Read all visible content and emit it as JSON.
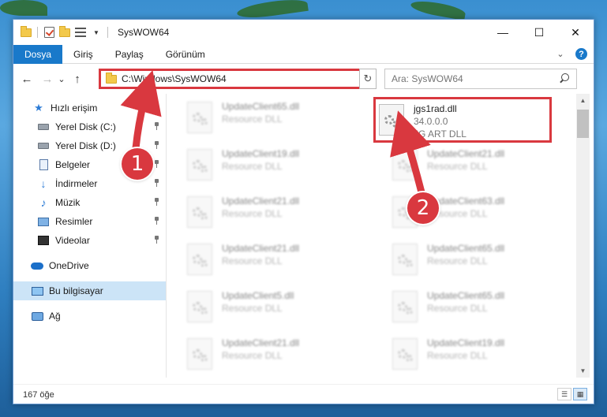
{
  "window": {
    "title": "SysWOW64",
    "minimize": "—",
    "maximize": "☐",
    "close": "✕"
  },
  "ribbon": {
    "tabs": [
      "Dosya",
      "Giriş",
      "Paylaş",
      "Görünüm"
    ],
    "help": "?"
  },
  "nav": {
    "back": "←",
    "forward": "→",
    "recent": "⌄",
    "up": "↑",
    "address": "C:\\Windows\\SysWOW64",
    "address_dropdown": "⌄",
    "refresh": "↻",
    "search_placeholder": "Ara: SysWOW64"
  },
  "sidebar": {
    "items": [
      {
        "label": "Hızlı erişim",
        "icon": "star-icon"
      },
      {
        "label": "Yerel Disk (C:)",
        "icon": "disk-icon",
        "pinned": true
      },
      {
        "label": "Yerel Disk (D:)",
        "icon": "disk-icon",
        "pinned": true
      },
      {
        "label": "Belgeler",
        "icon": "document-icon",
        "pinned": true
      },
      {
        "label": "İndirmeler",
        "icon": "download-icon",
        "pinned": true
      },
      {
        "label": "Müzik",
        "icon": "music-icon",
        "pinned": true
      },
      {
        "label": "Resimler",
        "icon": "pictures-icon",
        "pinned": true
      },
      {
        "label": "Videolar",
        "icon": "video-icon",
        "pinned": true
      },
      {
        "label": "OneDrive",
        "icon": "cloud-icon"
      },
      {
        "label": "Bu bilgisayar",
        "icon": "computer-icon",
        "selected": true
      },
      {
        "label": "Ağ",
        "icon": "network-icon"
      }
    ]
  },
  "files": [
    {
      "name": "UpdateClient65.dll",
      "type": "Resource DLL"
    },
    {
      "name": "jgs1rad.dll",
      "type": "34.0.0.0",
      "company": "JG ART DLL",
      "highlighted": true
    },
    {
      "name": "UpdateClient19.dll",
      "type": "Resource DLL"
    },
    {
      "name": "UpdateClient21.dll",
      "type": "Resource DLL"
    },
    {
      "name": "UpdateClient21.dll",
      "type": "Resource DLL"
    },
    {
      "name": "UpdateClient63.dll",
      "type": "Resource DLL"
    },
    {
      "name": "UpdateClient21.dll",
      "type": "Resource DLL"
    },
    {
      "name": "UpdateClient65.dll",
      "type": "Resource DLL"
    },
    {
      "name": "UpdateClient5.dll",
      "type": "Resource DLL"
    },
    {
      "name": "UpdateClient65.dll",
      "type": "Resource DLL"
    },
    {
      "name": "UpdateClient21.dll",
      "type": "Resource DLL"
    },
    {
      "name": "UpdateClient19.dll",
      "type": "Resource DLL"
    }
  ],
  "status": {
    "item_count": "167 öğe"
  },
  "annotations": {
    "step1": "1",
    "step2": "2",
    "accent_color": "#d9383f"
  }
}
